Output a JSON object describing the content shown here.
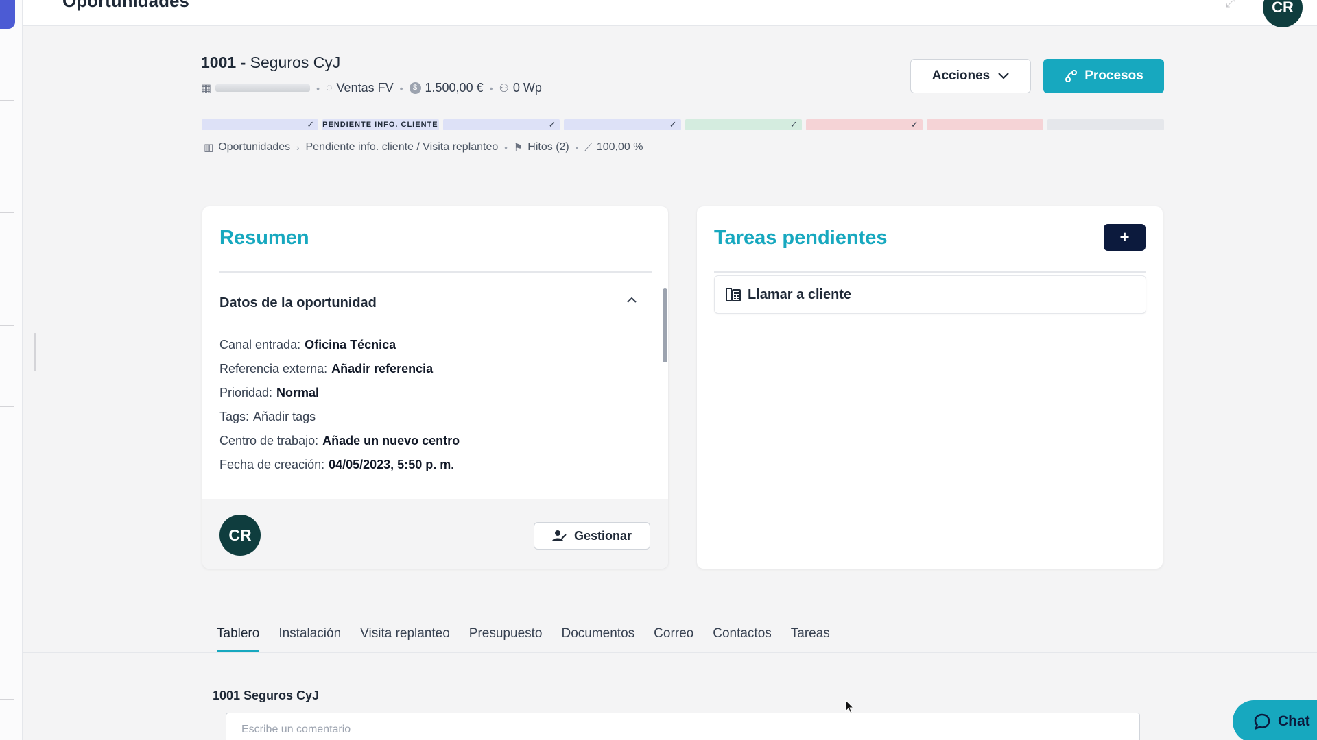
{
  "app": {
    "page_title": "Oportunidades",
    "user_initials": "CR"
  },
  "record": {
    "id": "1001",
    "dash": "-",
    "name": "Seguros CyJ",
    "meta": {
      "pipeline": "Ventas FV",
      "amount": "1.500,00 €",
      "power": "0 Wp"
    },
    "actions_label": "Acciones",
    "processes_label": "Procesos"
  },
  "stages": [
    {
      "label": "",
      "state": "done",
      "color": "#dde1f7"
    },
    {
      "label": "PENDIENTE INFO. CLIENTE ...",
      "state": "current",
      "color": "#dde1f7"
    },
    {
      "label": "",
      "state": "done",
      "color": "#dde1f7"
    },
    {
      "label": "",
      "state": "done",
      "color": "#dde1f7"
    },
    {
      "label": "",
      "state": "done",
      "color": "#d4ecdf"
    },
    {
      "label": "",
      "state": "done",
      "color": "#f5d3d6"
    },
    {
      "label": "",
      "state": "pending",
      "color": "#f5d3d6"
    },
    {
      "label": "",
      "state": "pending",
      "color": "#e5e7eb"
    }
  ],
  "breadcrumb": {
    "root": "Oportunidades",
    "current": "Pendiente info. cliente / Visita replanteo",
    "milestones": "Hitos (2)",
    "probability": "100,00 %"
  },
  "resumen": {
    "title": "Resumen",
    "section_title": "Datos de la oportunidad",
    "fields": [
      {
        "label": "Canal entrada:",
        "value": "Oficina Técnica"
      },
      {
        "label": "Referencia externa:",
        "value": "Añadir referencia"
      },
      {
        "label": "Prioridad:",
        "value": "Normal"
      },
      {
        "label": "Tags:",
        "value": "Añadir tags"
      },
      {
        "label": "Centro de trabajo:",
        "value": "Añade un nuevo centro"
      },
      {
        "label": "Fecha de creación:",
        "value": "04/05/2023, 5:50 p. m."
      }
    ],
    "owner_initials": "CR",
    "manage_label": "Gestionar"
  },
  "tareas": {
    "title": "Tareas pendientes",
    "add_label": "+",
    "items": [
      {
        "label": "Llamar a cliente"
      }
    ]
  },
  "tabs": [
    {
      "label": "Tablero",
      "active": true
    },
    {
      "label": "Instalación"
    },
    {
      "label": "Visita replanteo"
    },
    {
      "label": "Presupuesto"
    },
    {
      "label": "Documentos"
    },
    {
      "label": "Correo"
    },
    {
      "label": "Contactos"
    },
    {
      "label": "Tareas"
    }
  ],
  "comments": {
    "heading": "1001 Seguros CyJ",
    "placeholder": "Escribe un comentario"
  },
  "chat": {
    "label": "Chat"
  },
  "colors": {
    "accent": "#17a8bf",
    "navy": "#0c1a3d",
    "avatar": "#0f3d3e"
  }
}
